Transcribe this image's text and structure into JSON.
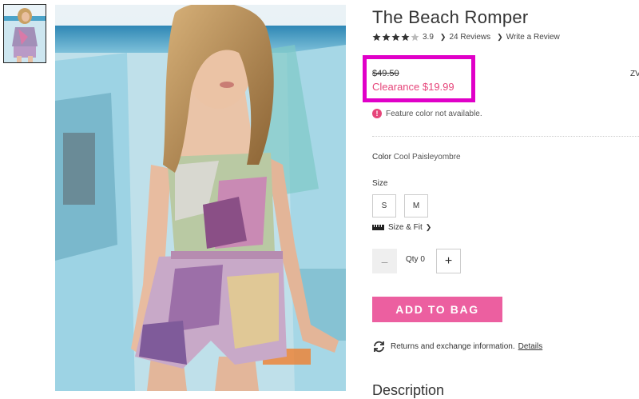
{
  "product": {
    "title": "The Beach Romper",
    "rating_value": "3.9",
    "rating_stars": 3.9,
    "reviews_link": "24 Reviews",
    "write_review_link": "Write a Review"
  },
  "price": {
    "original": "$49.50",
    "clearance": "Clearance $19.99"
  },
  "edge_text": "ZV",
  "notice": {
    "icon": "alert-icon",
    "text": "Feature color not available."
  },
  "color": {
    "label": "Color",
    "value": "Cool Paisleyombre"
  },
  "size": {
    "label": "Size",
    "options": [
      "S",
      "M"
    ],
    "fit_link": "Size & Fit"
  },
  "quantity": {
    "minus": "–",
    "label": "Qty 0",
    "plus": "+"
  },
  "add_to_bag": "ADD TO BAG",
  "returns": {
    "text": "Returns and exchange information.",
    "link": "Details"
  },
  "description_heading": "Description",
  "colors": {
    "accent_pink": "#ec5fa0",
    "sale_text": "#e6457a",
    "highlight_box": "#e000c8"
  }
}
